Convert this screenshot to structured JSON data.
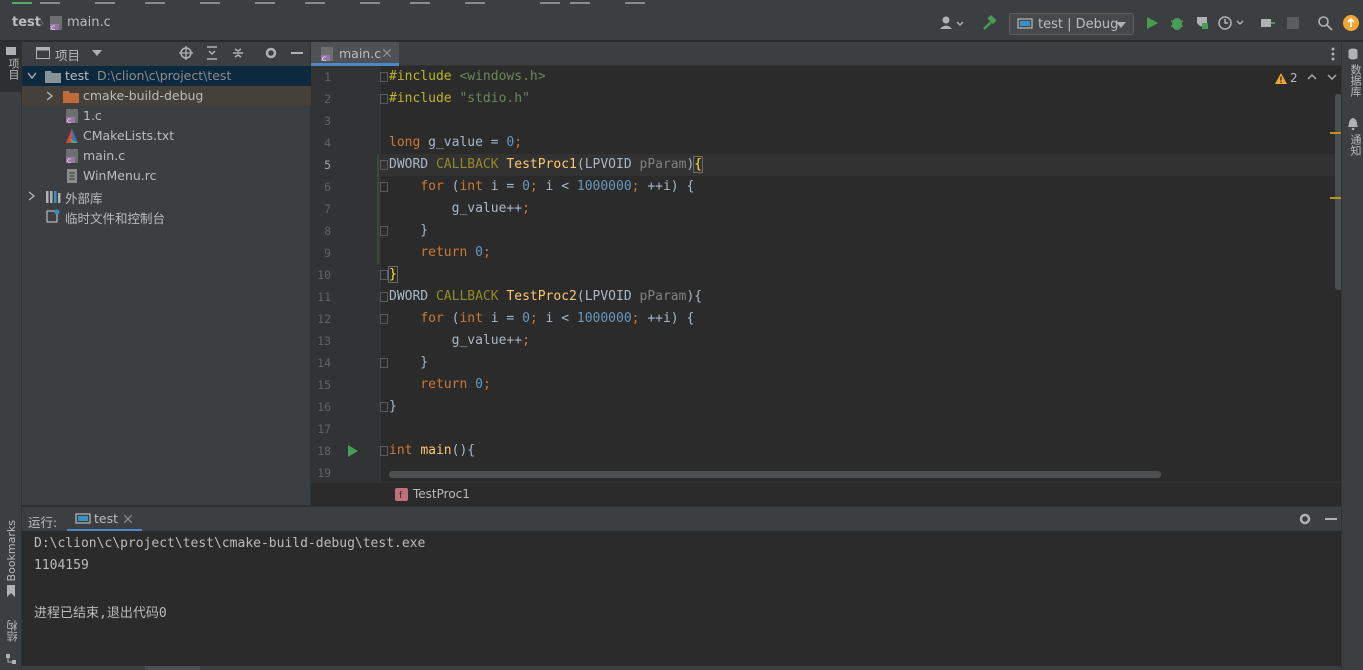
{
  "breadcrumb": {
    "project": "test",
    "file": "main.c"
  },
  "toolbar": {
    "run_config": "test | Debug"
  },
  "left_strip": {
    "project_tab": "项目",
    "bookmarks_tab": "Bookmarks",
    "structure_tab": "结构"
  },
  "right_strip": {
    "database_tab": "数据库",
    "notifications_tab": "通知"
  },
  "project_panel": {
    "title": "项目",
    "tree": [
      {
        "label": "test",
        "path": "D:\\clion\\c\\project\\test"
      },
      {
        "label": "cmake-build-debug"
      },
      {
        "label": "1.c"
      },
      {
        "label": "CMakeLists.txt"
      },
      {
        "label": "main.c"
      },
      {
        "label": "WinMenu.rc"
      },
      {
        "label": "外部库"
      },
      {
        "label": "临时文件和控制台"
      }
    ]
  },
  "editor": {
    "tab_label": "main.c",
    "warnings_count": "2",
    "line_numbers": [
      "1",
      "2",
      "3",
      "4",
      "5",
      "6",
      "7",
      "8",
      "9",
      "10",
      "11",
      "12",
      "13",
      "14",
      "15",
      "16",
      "17",
      "18",
      "19"
    ],
    "breadcrumb_function": "TestProc1"
  },
  "run_panel": {
    "label": "运行:",
    "tab": "test",
    "output": [
      "D:\\clion\\c\\project\\test\\cmake-build-debug\\test.exe",
      "1104159",
      "",
      "进程已结束,退出代码0"
    ]
  },
  "colors": {
    "keyword": "#cc7832",
    "string": "#6a8759",
    "number": "#6897bb",
    "function": "#ffc66d",
    "accent": "#4a88c7",
    "run_green": "#499c54"
  }
}
